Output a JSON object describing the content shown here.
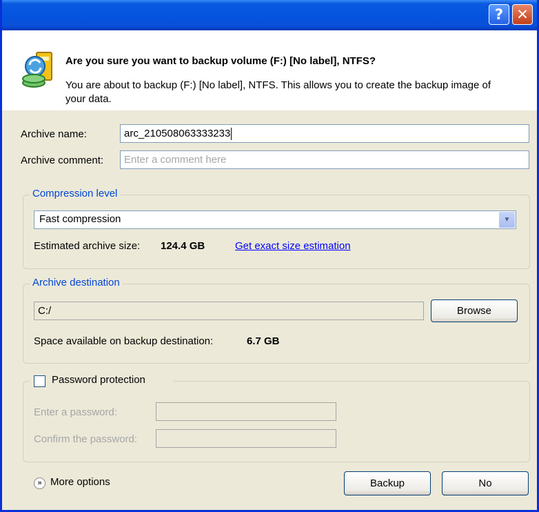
{
  "title_bar": {
    "help_glyph": "?",
    "close_glyph": "✕"
  },
  "header": {
    "title": "Are you sure you want to backup volume (F:) [No label], NTFS?",
    "description": "You are about to backup (F:) [No label], NTFS. This allows you to create the backup image of your data."
  },
  "archive_name": {
    "label": "Archive name:",
    "value": "arc_210508063333233"
  },
  "archive_comment": {
    "label": "Archive comment:",
    "placeholder": "Enter a comment here"
  },
  "compression": {
    "legend": "Compression level",
    "selected": "Fast compression",
    "estimated_label": "Estimated archive size:",
    "estimated_value": "124.4 GB",
    "exact_link": "Get exact size estimation"
  },
  "destination": {
    "legend": "Archive destination",
    "path": "C:/",
    "browse_label": "Browse",
    "space_label": "Space available on backup destination:",
    "space_value": "6.7 GB"
  },
  "password": {
    "legend": "Password protection",
    "checked": false,
    "enter_label": "Enter a password:",
    "confirm_label": "Confirm the password:"
  },
  "footer": {
    "more_options": "More options",
    "backup_label": "Backup",
    "no_label": "No"
  },
  "colors": {
    "titlebar": "#0a5be0",
    "legend": "#0046d5",
    "link": "#0000ff",
    "close": "#c23f19"
  }
}
